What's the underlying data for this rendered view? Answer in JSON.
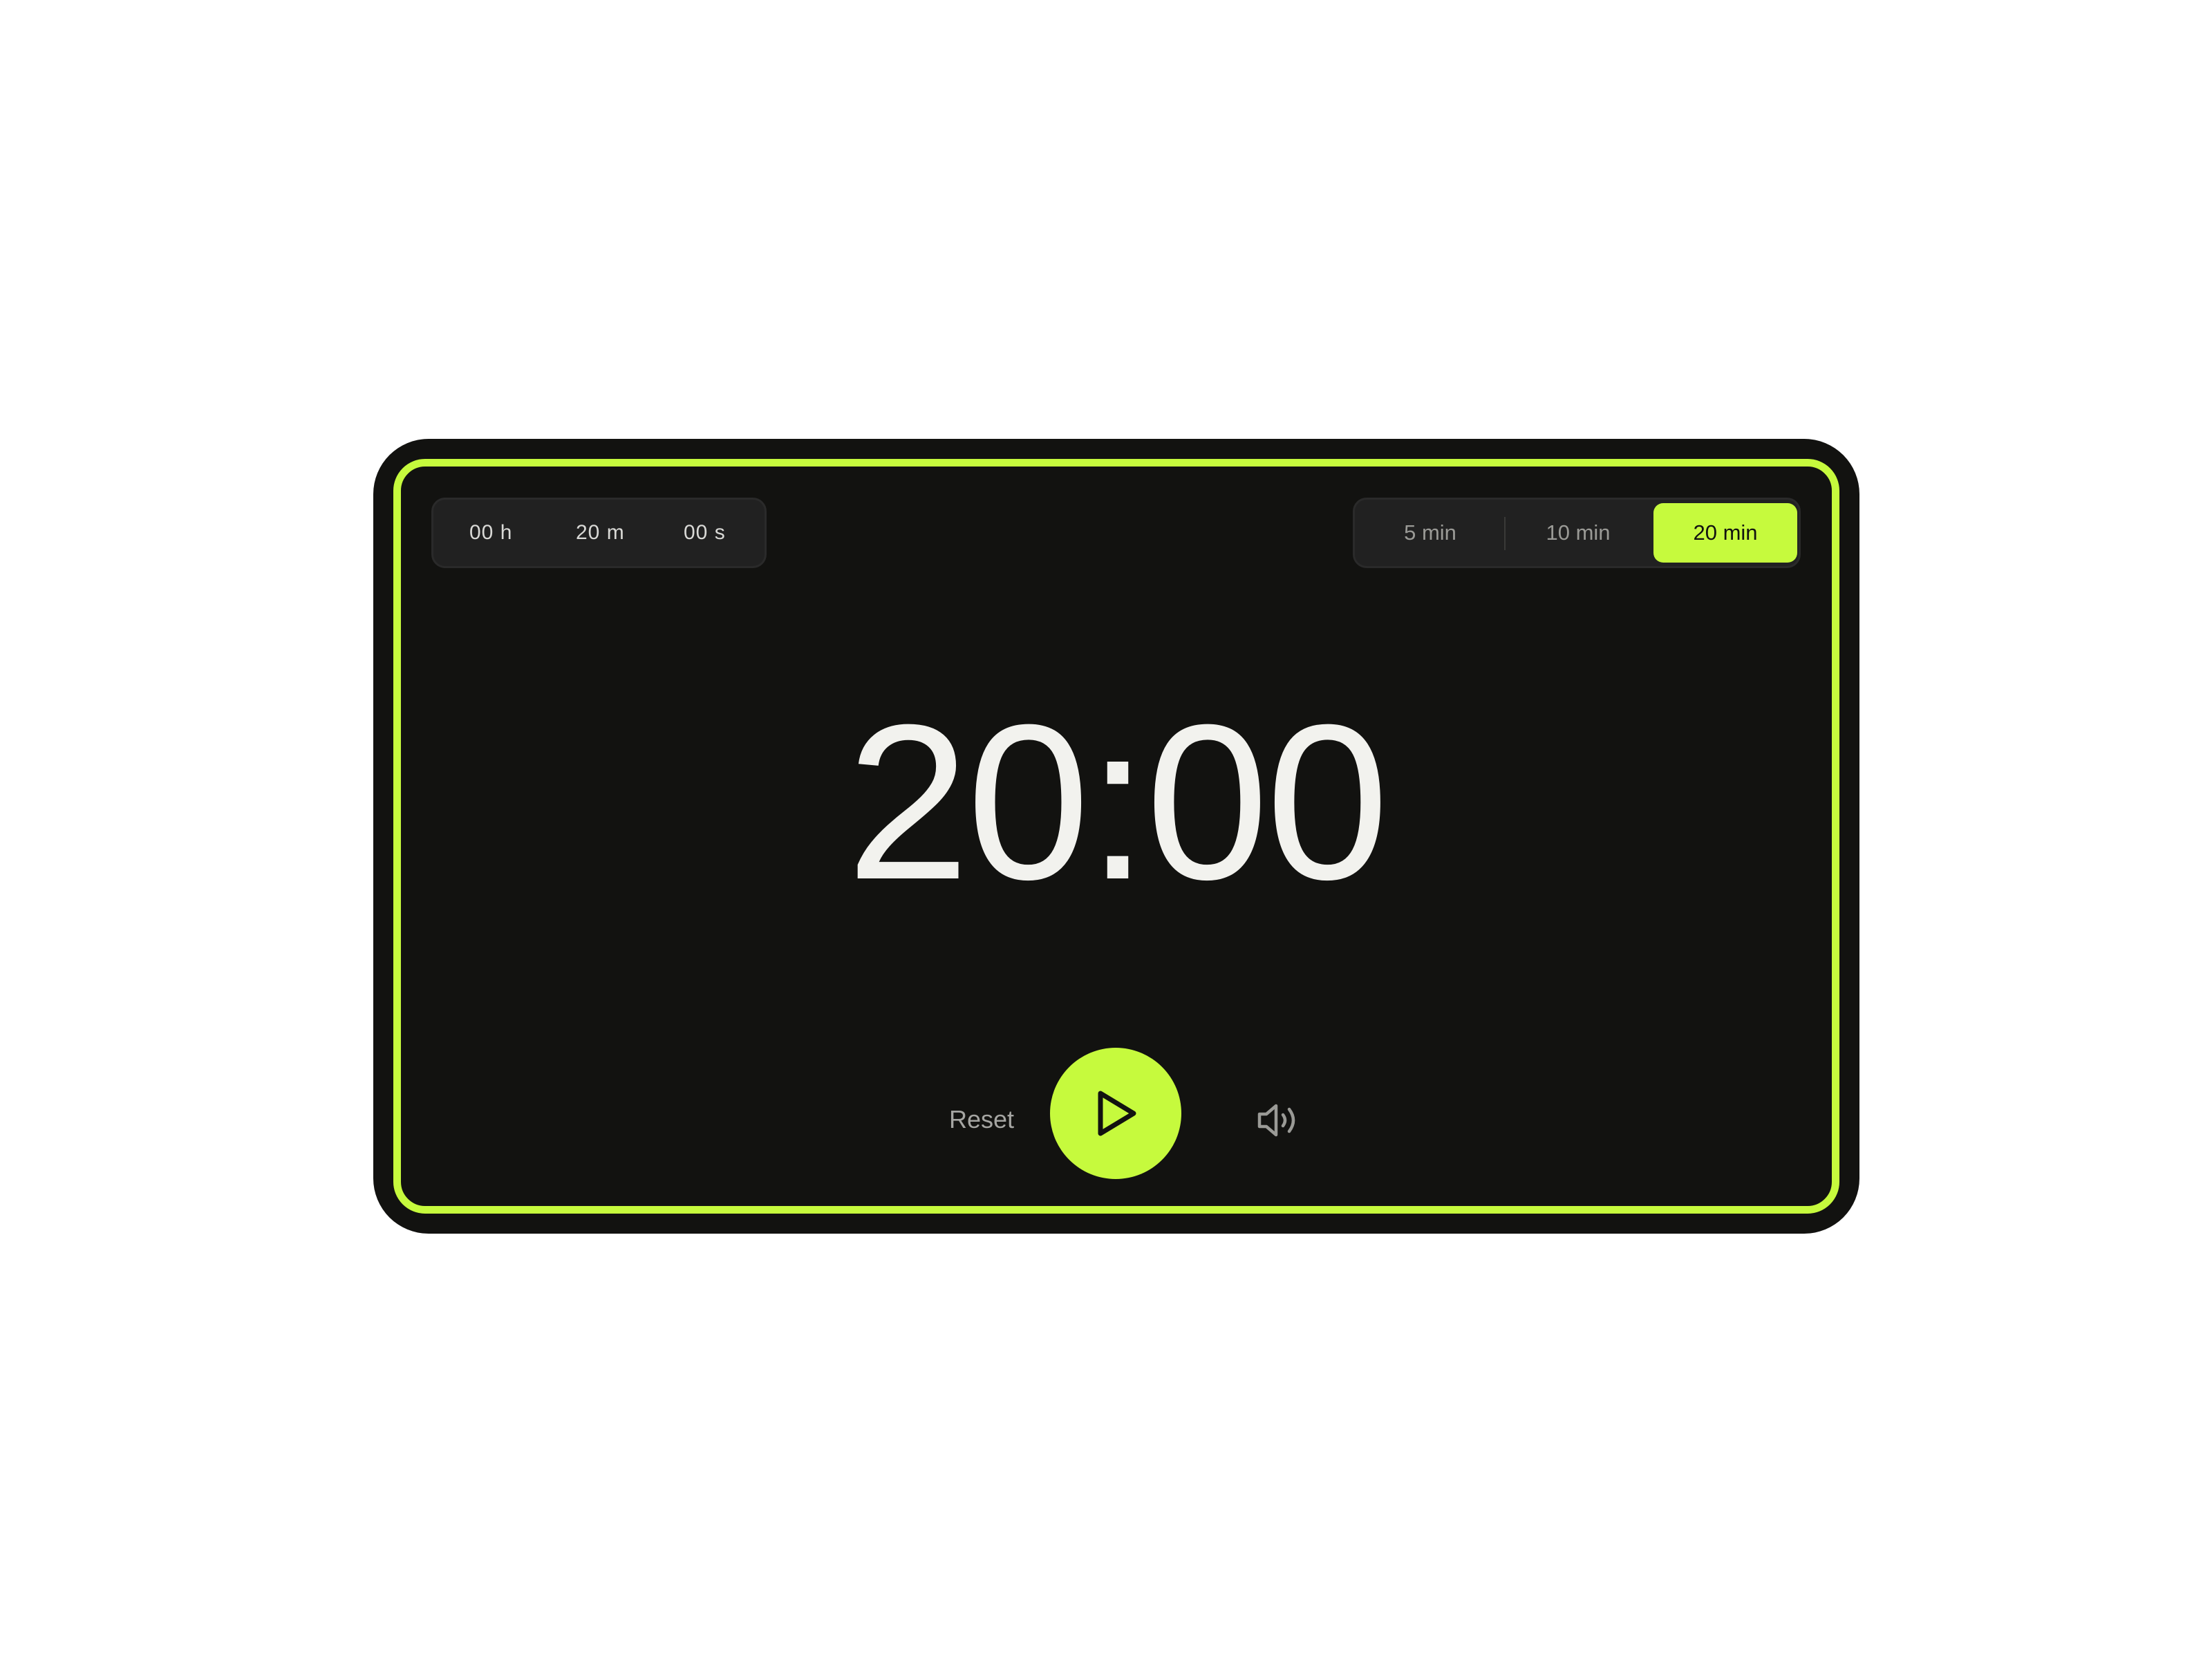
{
  "time_inputs": {
    "hours": "00 h",
    "minutes": "20 m",
    "seconds": "00 s"
  },
  "presets": [
    {
      "label": "5 min",
      "active": false
    },
    {
      "label": "10 min",
      "active": false
    },
    {
      "label": "20 min",
      "active": true
    }
  ],
  "display": {
    "time": "20:00"
  },
  "controls": {
    "reset_label": "Reset",
    "play_icon": "play-icon",
    "sound_icon": "speaker-volume-icon"
  },
  "colors": {
    "accent": "#c6fa3d",
    "background": "#121210",
    "panel": "#212121",
    "text": "#f2f2ee",
    "muted": "#9a9a96"
  }
}
